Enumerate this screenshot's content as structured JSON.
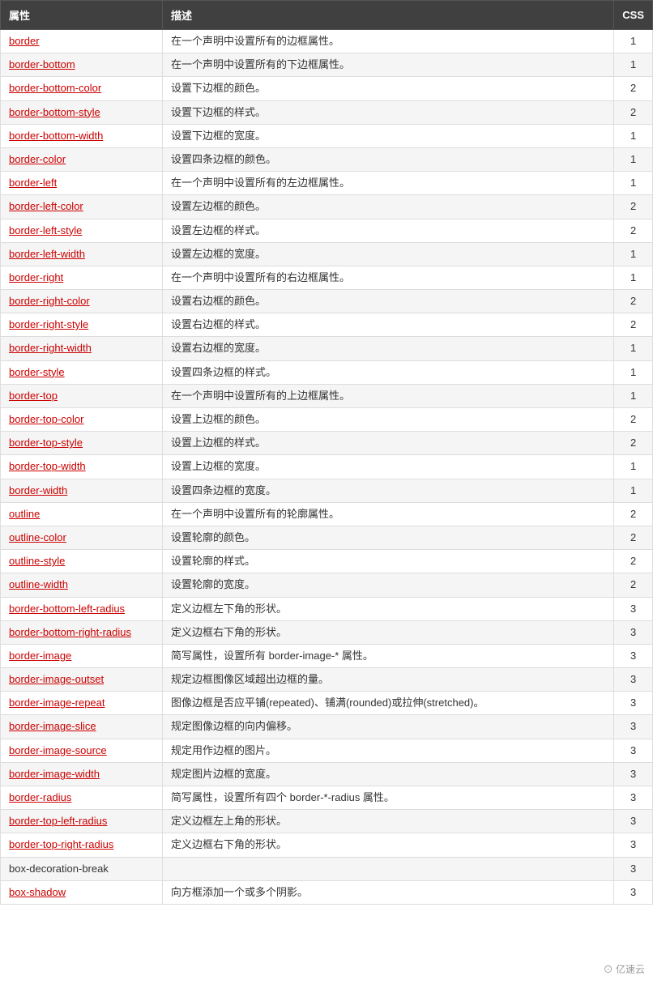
{
  "header": {
    "col1": "属性",
    "col2": "描述",
    "col3": "CSS"
  },
  "rows": [
    {
      "prop": "border",
      "desc": "在一个声明中设置所有的边框属性。",
      "css": "1",
      "link": true
    },
    {
      "prop": "border-bottom",
      "desc": "在一个声明中设置所有的下边框属性。",
      "css": "1",
      "link": true
    },
    {
      "prop": "border-bottom-color",
      "desc": "设置下边框的颜色。",
      "css": "2",
      "link": true
    },
    {
      "prop": "border-bottom-style",
      "desc": "设置下边框的样式。",
      "css": "2",
      "link": true
    },
    {
      "prop": "border-bottom-width",
      "desc": "设置下边框的宽度。",
      "css": "1",
      "link": true
    },
    {
      "prop": "border-color",
      "desc": "设置四条边框的颜色。",
      "css": "1",
      "link": true
    },
    {
      "prop": "border-left",
      "desc": "在一个声明中设置所有的左边框属性。",
      "css": "1",
      "link": true
    },
    {
      "prop": "border-left-color",
      "desc": "设置左边框的颜色。",
      "css": "2",
      "link": true
    },
    {
      "prop": "border-left-style",
      "desc": "设置左边框的样式。",
      "css": "2",
      "link": true
    },
    {
      "prop": "border-left-width",
      "desc": "设置左边框的宽度。",
      "css": "1",
      "link": true
    },
    {
      "prop": "border-right",
      "desc": "在一个声明中设置所有的右边框属性。",
      "css": "1",
      "link": true
    },
    {
      "prop": "border-right-color",
      "desc": "设置右边框的颜色。",
      "css": "2",
      "link": true
    },
    {
      "prop": "border-right-style",
      "desc": "设置右边框的样式。",
      "css": "2",
      "link": true
    },
    {
      "prop": "border-right-width",
      "desc": "设置右边框的宽度。",
      "css": "1",
      "link": true
    },
    {
      "prop": "border-style",
      "desc": "设置四条边框的样式。",
      "css": "1",
      "link": true
    },
    {
      "prop": "border-top",
      "desc": "在一个声明中设置所有的上边框属性。",
      "css": "1",
      "link": true
    },
    {
      "prop": "border-top-color",
      "desc": "设置上边框的颜色。",
      "css": "2",
      "link": true
    },
    {
      "prop": "border-top-style",
      "desc": "设置上边框的样式。",
      "css": "2",
      "link": true
    },
    {
      "prop": "border-top-width",
      "desc": "设置上边框的宽度。",
      "css": "1",
      "link": true
    },
    {
      "prop": "border-width",
      "desc": "设置四条边框的宽度。",
      "css": "1",
      "link": true
    },
    {
      "prop": "outline",
      "desc": "在一个声明中设置所有的轮廓属性。",
      "css": "2",
      "link": true
    },
    {
      "prop": "outline-color",
      "desc": "设置轮廓的颜色。",
      "css": "2",
      "link": true
    },
    {
      "prop": "outline-style",
      "desc": "设置轮廓的样式。",
      "css": "2",
      "link": true
    },
    {
      "prop": "outline-width",
      "desc": "设置轮廓的宽度。",
      "css": "2",
      "link": true
    },
    {
      "prop": "border-bottom-left-radius",
      "desc": "定义边框左下角的形状。",
      "css": "3",
      "link": true
    },
    {
      "prop": "border-bottom-right-radius",
      "desc": "定义边框右下角的形状。",
      "css": "3",
      "link": true
    },
    {
      "prop": "border-image",
      "desc": "简写属性，设置所有 border-image-* 属性。",
      "css": "3",
      "link": true
    },
    {
      "prop": "border-image-outset",
      "desc": "规定边框图像区域超出边框的量。",
      "css": "3",
      "link": true
    },
    {
      "prop": "border-image-repeat",
      "desc": "图像边框是否应平铺(repeated)、铺满(rounded)或拉伸(stretched)。",
      "css": "3",
      "link": true
    },
    {
      "prop": "border-image-slice",
      "desc": "规定图像边框的向内偏移。",
      "css": "3",
      "link": true
    },
    {
      "prop": "border-image-source",
      "desc": "规定用作边框的图片。",
      "css": "3",
      "link": true
    },
    {
      "prop": "border-image-width",
      "desc": "规定图片边框的宽度。",
      "css": "3",
      "link": true
    },
    {
      "prop": "border-radius",
      "desc": "简写属性，设置所有四个 border-*-radius 属性。",
      "css": "3",
      "link": true
    },
    {
      "prop": "border-top-left-radius",
      "desc": "定义边框左上角的形状。",
      "css": "3",
      "link": true
    },
    {
      "prop": "border-top-right-radius",
      "desc": "定义边框右下角的形状。",
      "css": "3",
      "link": true
    },
    {
      "prop": "box-decoration-break",
      "desc": "",
      "css": "3",
      "link": false
    },
    {
      "prop": "box-shadow",
      "desc": "向方框添加一个或多个阴影。",
      "css": "3",
      "link": true
    }
  ],
  "watermark": "⊙ 亿速云"
}
